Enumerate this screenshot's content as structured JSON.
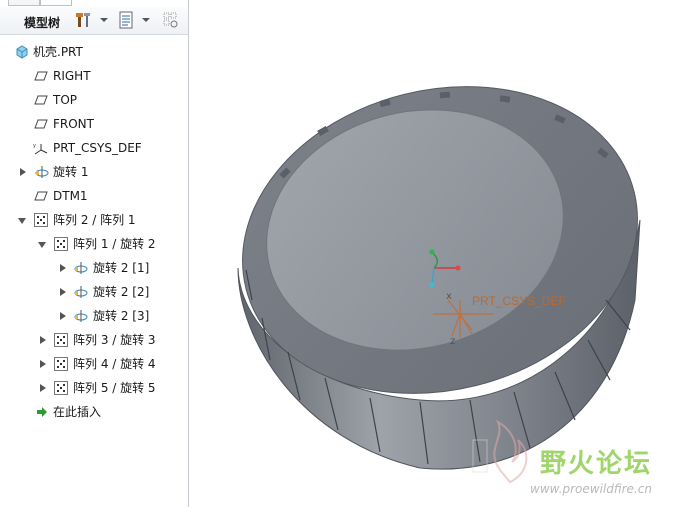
{
  "panel": {
    "title": "模型树"
  },
  "tree": {
    "root": "机壳.PRT",
    "items": [
      {
        "label": "RIGHT"
      },
      {
        "label": "TOP"
      },
      {
        "label": "FRONT"
      },
      {
        "label": "PRT_CSYS_DEF"
      },
      {
        "label": "旋转 1"
      },
      {
        "label": "DTM1"
      },
      {
        "label": "阵列 2 / 阵列 1"
      },
      {
        "label": "阵列 1 / 旋转 2"
      },
      {
        "label": "旋转 2 [1]"
      },
      {
        "label": "旋转 2 [2]"
      },
      {
        "label": "旋转 2 [3]"
      },
      {
        "label": "阵列 3 / 旋转 3"
      },
      {
        "label": "阵列 4 / 旋转 4"
      },
      {
        "label": "阵列 5 / 旋转 5"
      },
      {
        "label": "在此插入"
      }
    ]
  },
  "viewport": {
    "csys_label": "PRT_CSYS_DEF",
    "axis_x": "x",
    "axis_z": "z"
  },
  "watermark": {
    "name": "野火论坛",
    "url": "www.proewildfire.cn"
  },
  "colors": {
    "model_top": "#8c9199",
    "model_side": "#6f747c",
    "csys": "#c0703a",
    "watermark_green": "#9fd56a"
  }
}
